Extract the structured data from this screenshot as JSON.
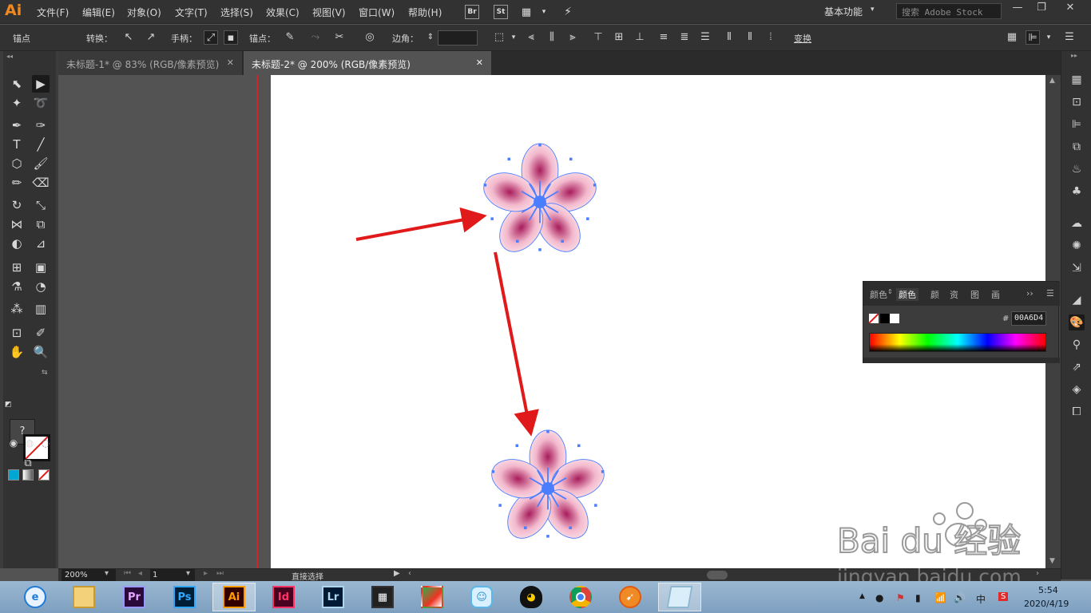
{
  "app": {
    "logo": "Ai",
    "menu": [
      "文件(F)",
      "编辑(E)",
      "对象(O)",
      "文字(T)",
      "选择(S)",
      "效果(C)",
      "视图(V)",
      "窗口(W)",
      "帮助(H)"
    ],
    "bridge_label": "Br",
    "stock_label": "St",
    "workspace": "基本功能",
    "search_placeholder": "搜索 Adobe Stock"
  },
  "control_bar": {
    "anchor_label": "锚点",
    "convert_label": "转换：",
    "handles_label": "手柄：",
    "anchors_label": "锚点：",
    "corner_label": "边角：",
    "transform_label": "变换"
  },
  "tabs": [
    {
      "label": "未标题-1* @ 83% (RGB/像素预览)",
      "active": false
    },
    {
      "label": "未标题-2* @ 200% (RGB/像素预览)",
      "active": true
    }
  ],
  "color_panel": {
    "tabs": [
      "颜色",
      "颜色",
      "颜",
      "资",
      "图",
      "画"
    ],
    "hex_prefix": "#",
    "hex_value": "00A6D4"
  },
  "status_bar": {
    "zoom": "200%",
    "page": "1",
    "tool_name": "直接选择"
  },
  "taskbar": {
    "apps": [
      "ie",
      "explorer",
      "Pr",
      "Ps",
      "Ai",
      "Id",
      "Lr",
      "video",
      "game",
      "qq-pet",
      "qq",
      "chrome",
      "browser",
      "notes"
    ],
    "time": "5:54",
    "date": "2020/4/19",
    "ime": "中"
  },
  "watermark": {
    "logo_text": "Bai du 经验",
    "url": "jingyan.baidu.com"
  },
  "colors": {
    "accent_ai": "#f0891f",
    "arrow": "#e01a1a",
    "anchor_blue": "#4a7dff",
    "petal_pink": "#f2b8cc",
    "petal_deep": "#a81c5c"
  }
}
